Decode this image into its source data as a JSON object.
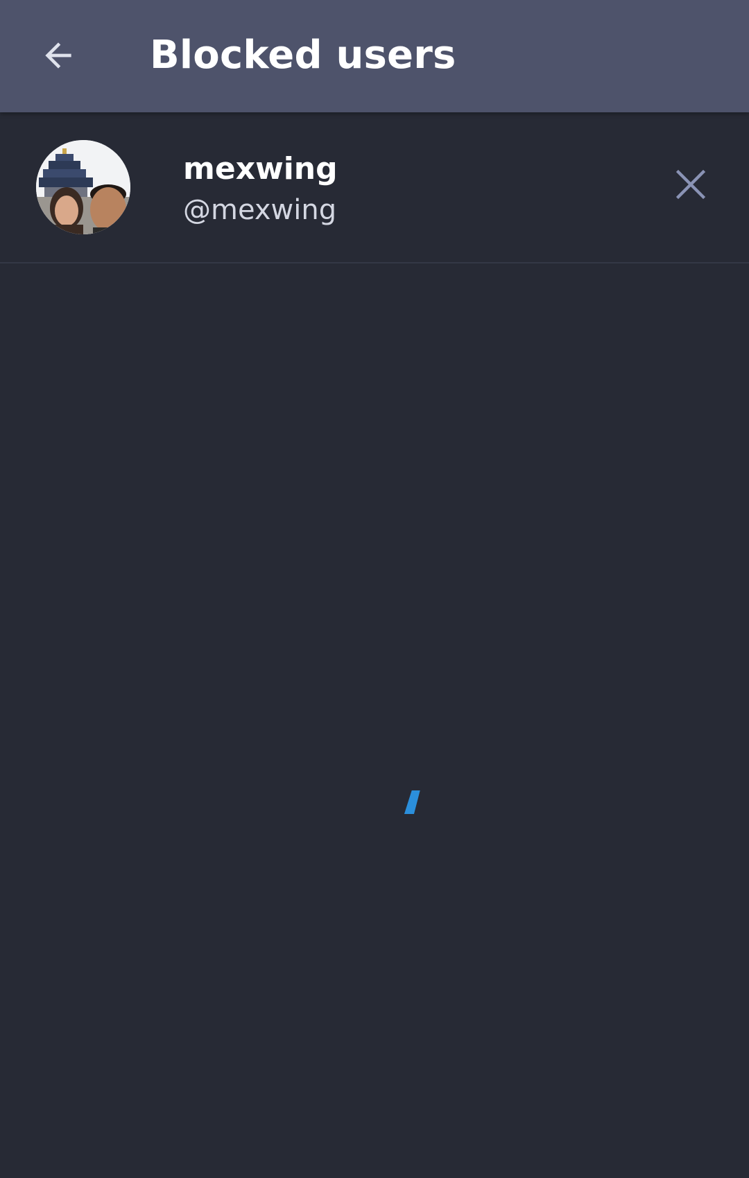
{
  "header": {
    "title": "Blocked users",
    "back_icon": "arrow-left-icon"
  },
  "blocked_users": [
    {
      "display_name": "mexwing",
      "handle": "@mexwing",
      "avatar": "profile-photo",
      "remove_icon": "close-icon"
    }
  ],
  "loading": {
    "icon": "spinner-icon",
    "color": "#2b8fdc"
  },
  "colors": {
    "appbar": "#4e536b",
    "background": "#272a35",
    "divider": "#343846",
    "icon": "#8a93b5"
  }
}
